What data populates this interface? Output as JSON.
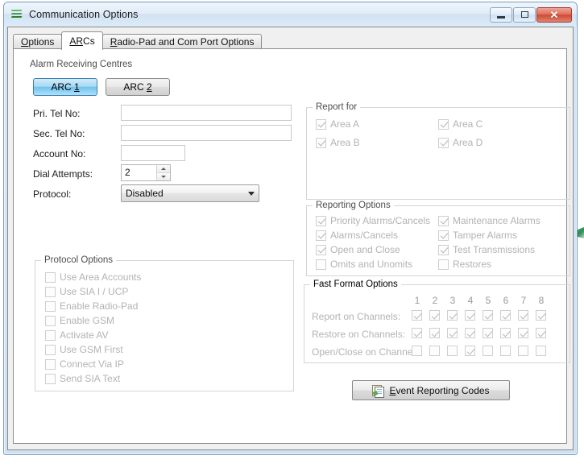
{
  "window": {
    "title": "Communication Options",
    "icon": "green-stripes-icon",
    "minimize_label": "Minimize",
    "maximize_label": "Maximize",
    "close_label": "Close"
  },
  "tabs": [
    {
      "label": "Options",
      "underline": "O",
      "active": false
    },
    {
      "label": "ARCs",
      "underline": "AR",
      "active": true
    },
    {
      "label": "Radio-Pad and Com Port Options",
      "underline": "R",
      "active": false
    }
  ],
  "arc_group": {
    "legend": "Alarm Receiving Centres",
    "buttons": [
      {
        "label": "ARC 1",
        "selected": true
      },
      {
        "label": "ARC 2",
        "selected": false
      }
    ],
    "fields": [
      {
        "label": "Pri. Tel No:",
        "value": "",
        "placeholder": ""
      },
      {
        "label": "Sec. Tel No:",
        "value": "",
        "placeholder": ""
      },
      {
        "label": "Account No:",
        "value": "",
        "placeholder": ""
      }
    ],
    "dial_attempts": {
      "label": "Dial Attempts:",
      "value": "2"
    },
    "protocol": {
      "label": "Protocol:",
      "value": "Disabled"
    }
  },
  "protocol_options": {
    "legend": "Protocol Options",
    "items": [
      {
        "label": "Use Area Accounts",
        "checked": false,
        "disabled": true
      },
      {
        "label": "Use SIA I / UCP",
        "checked": false,
        "disabled": true
      },
      {
        "label": "Enable Radio-Pad",
        "checked": false,
        "disabled": true
      },
      {
        "label": "Enable GSM",
        "checked": false,
        "disabled": true
      },
      {
        "label": "Activate AV",
        "checked": false,
        "disabled": true
      },
      {
        "label": "Use GSM First",
        "checked": false,
        "disabled": true
      },
      {
        "label": "Connect Via IP",
        "checked": false,
        "disabled": true
      },
      {
        "label": "Send SIA Text",
        "checked": false,
        "disabled": true
      }
    ]
  },
  "report_for": {
    "legend": "Report for",
    "column_left": [
      {
        "label": "Area A",
        "checked": true,
        "disabled": true
      },
      {
        "label": "Area B",
        "checked": true,
        "disabled": true
      }
    ],
    "column_right": [
      {
        "label": "Area C",
        "checked": true,
        "disabled": true
      },
      {
        "label": "Area D",
        "checked": true,
        "disabled": true
      }
    ]
  },
  "reporting_options": {
    "legend": "Reporting Options",
    "column_left": [
      {
        "label": "Priority Alarms/Cancels",
        "checked": true,
        "disabled": true
      },
      {
        "label": "Alarms/Cancels",
        "checked": true,
        "disabled": true
      },
      {
        "label": "Open and Close",
        "checked": true,
        "disabled": true
      },
      {
        "label": "Omits and Unomits",
        "checked": false,
        "disabled": true
      }
    ],
    "column_right": [
      {
        "label": "Maintenance Alarms",
        "checked": true,
        "disabled": true
      },
      {
        "label": "Tamper Alarms",
        "checked": true,
        "disabled": true
      },
      {
        "label": "Test Transmissions",
        "checked": true,
        "disabled": true
      },
      {
        "label": "Restores",
        "checked": false,
        "disabled": true
      }
    ]
  },
  "fast_format": {
    "legend": "Fast Format Options",
    "channel_numbers": [
      "1",
      "2",
      "3",
      "4",
      "5",
      "6",
      "7",
      "8"
    ],
    "rows": [
      {
        "label": "Report on Channels:",
        "checked": [
          true,
          true,
          true,
          true,
          true,
          true,
          true,
          true
        ]
      },
      {
        "label": "Restore on Channels:",
        "checked": [
          true,
          true,
          true,
          true,
          true,
          true,
          true,
          true
        ]
      },
      {
        "label": "Open/Close on Channels:",
        "checked": [
          false,
          false,
          false,
          true,
          false,
          false,
          false,
          false
        ]
      }
    ]
  },
  "event_reporting_codes_button": {
    "label": "Event Reporting Codes",
    "underline": "E",
    "icon": "report-document-icon"
  },
  "colors": {
    "accent_blue": "#6fc2ef",
    "titlebar": "#dcebf8",
    "close_red": "#cf4a33",
    "disabled_text": "#b3b3b3",
    "group_border": "#d5d5d5"
  }
}
